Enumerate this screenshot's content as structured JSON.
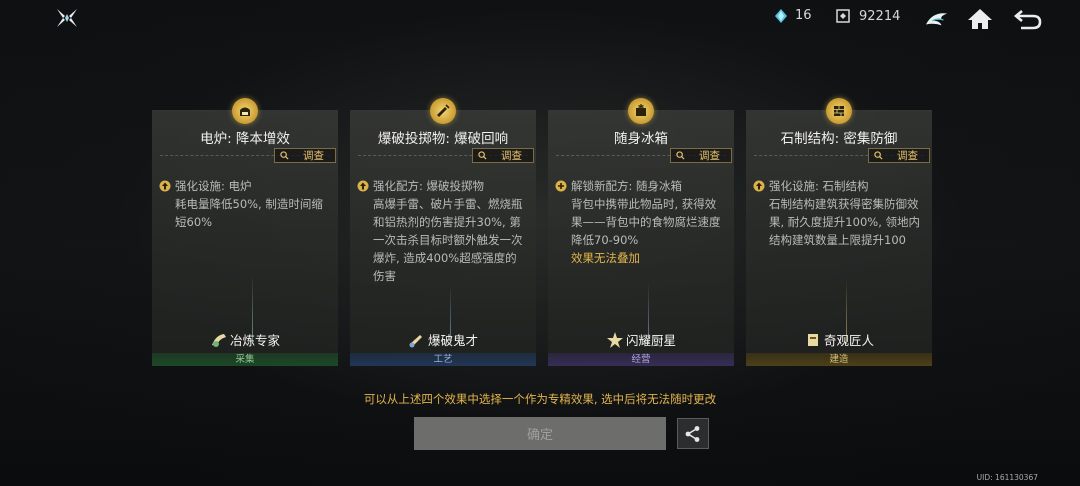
{
  "top_bar": {
    "logo_icon": "crossed-blades-icon",
    "gem_count": "16",
    "coin_count": "92214",
    "icons": [
      "dragon-icon",
      "home-icon",
      "back-arrow-icon"
    ]
  },
  "cards": [
    {
      "icon": "furnace-icon",
      "title": "电炉: 降本增效",
      "inspect_label": "调查",
      "desc_lead": "强化设施: 电炉",
      "desc_body": "耗电量降低50%, 制造时间缩短60%",
      "desc_warn": "",
      "spec_name": "冶炼专家",
      "spec_category": "采集",
      "category_color": "#2e6b3d"
    },
    {
      "icon": "explosive-icon",
      "title": "爆破投掷物: 爆破回响",
      "inspect_label": "调查",
      "desc_lead": "强化配方: 爆破投掷物",
      "desc_body": "高爆手雷、破片手雷、燃烧瓶和铝热剂的伤害提升30%, 第一次击杀目标时额外触发一次爆炸, 造成400%超感强度的伤害",
      "desc_warn": "",
      "spec_name": "爆破鬼才",
      "spec_category": "工艺",
      "category_color": "#2a4a7a"
    },
    {
      "icon": "icebox-icon",
      "title": "随身冰箱",
      "inspect_label": "调查",
      "desc_lead": "解锁新配方: 随身冰箱",
      "desc_body": "背包中携带此物品时, 获得效果——背包中的食物腐烂速度降低70-90%",
      "desc_warn": "效果无法叠加",
      "spec_name": "闪耀厨星",
      "spec_category": "经营",
      "category_color": "#4a3c7a"
    },
    {
      "icon": "stone-structure-icon",
      "title": "石制结构: 密集防御",
      "inspect_label": "调查",
      "desc_lead": "强化设施: 石制结构",
      "desc_body": "石制结构建筑获得密集防御效果, 耐久度提升100%, 领地内结构建筑数量上限提升100",
      "desc_warn": "",
      "spec_name": "奇观匠人",
      "spec_category": "建造",
      "category_color": "#6b5618"
    }
  ],
  "hint": "可以从上述四个效果中选择一个作为专精效果, 选中后将无法随时更改",
  "confirm_label": "确定",
  "share_icon": "share-icon",
  "uid_label": "UID: 161130367"
}
